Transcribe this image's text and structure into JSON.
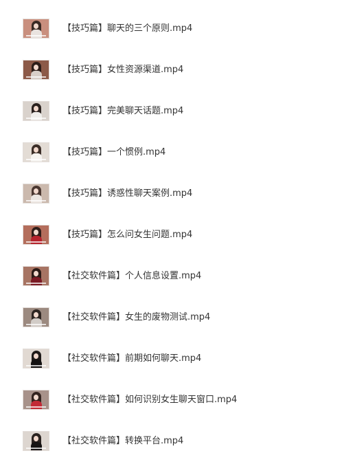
{
  "files": [
    {
      "name": "【技巧篇】聊天的三个原则.mp4",
      "thumb": {
        "bg": "#c98f7e",
        "hair": "#3a2a24",
        "body": "#e9e3df"
      }
    },
    {
      "name": "【技巧篇】女性资源渠道.mp4",
      "thumb": {
        "bg": "#8c5a48",
        "hair": "#2c1d18",
        "body": "#d8cfc8"
      }
    },
    {
      "name": "【技巧篇】完美聊天话题.mp4",
      "thumb": {
        "bg": "#d9d2cc",
        "hair": "#2a211e",
        "body": "#f0eeeb"
      }
    },
    {
      "name": "【技巧篇】一个惯例.mp4",
      "thumb": {
        "bg": "#e3dcd5",
        "hair": "#3b2e28",
        "body": "#f6f4f1"
      }
    },
    {
      "name": "【技巧篇】诱惑性聊天案例.mp4",
      "thumb": {
        "bg": "#cbb9ad",
        "hair": "#4a3730",
        "body": "#ece6e1"
      }
    },
    {
      "name": "【技巧篇】怎么问女生问题.mp4",
      "thumb": {
        "bg": "#b46e5c",
        "hair": "#2f1e19",
        "body": "#b5232d"
      }
    },
    {
      "name": "【社交软件篇】个人信息设置.mp4",
      "thumb": {
        "bg": "#a77463",
        "hair": "#2b1b16",
        "body": "#7a1a24"
      }
    },
    {
      "name": "【社交软件篇】女生的废物测试.mp4",
      "thumb": {
        "bg": "#9c8a80",
        "hair": "#2e2521",
        "body": "#d2ccc7"
      }
    },
    {
      "name": "【社交软件篇】前期如何聊天.mp4",
      "thumb": {
        "bg": "#e1d9d2",
        "hair": "#1f1a18",
        "body": "#141212"
      }
    },
    {
      "name": "【社交软件篇】如何识别女生聊天窗口.mp4",
      "thumb": {
        "bg": "#a8928a",
        "hair": "#33231e",
        "body": "#c22a36"
      }
    },
    {
      "name": "【社交软件篇】转换平台.mp4",
      "thumb": {
        "bg": "#ddd6d0",
        "hair": "#2a2320",
        "body": "#161414"
      }
    }
  ]
}
